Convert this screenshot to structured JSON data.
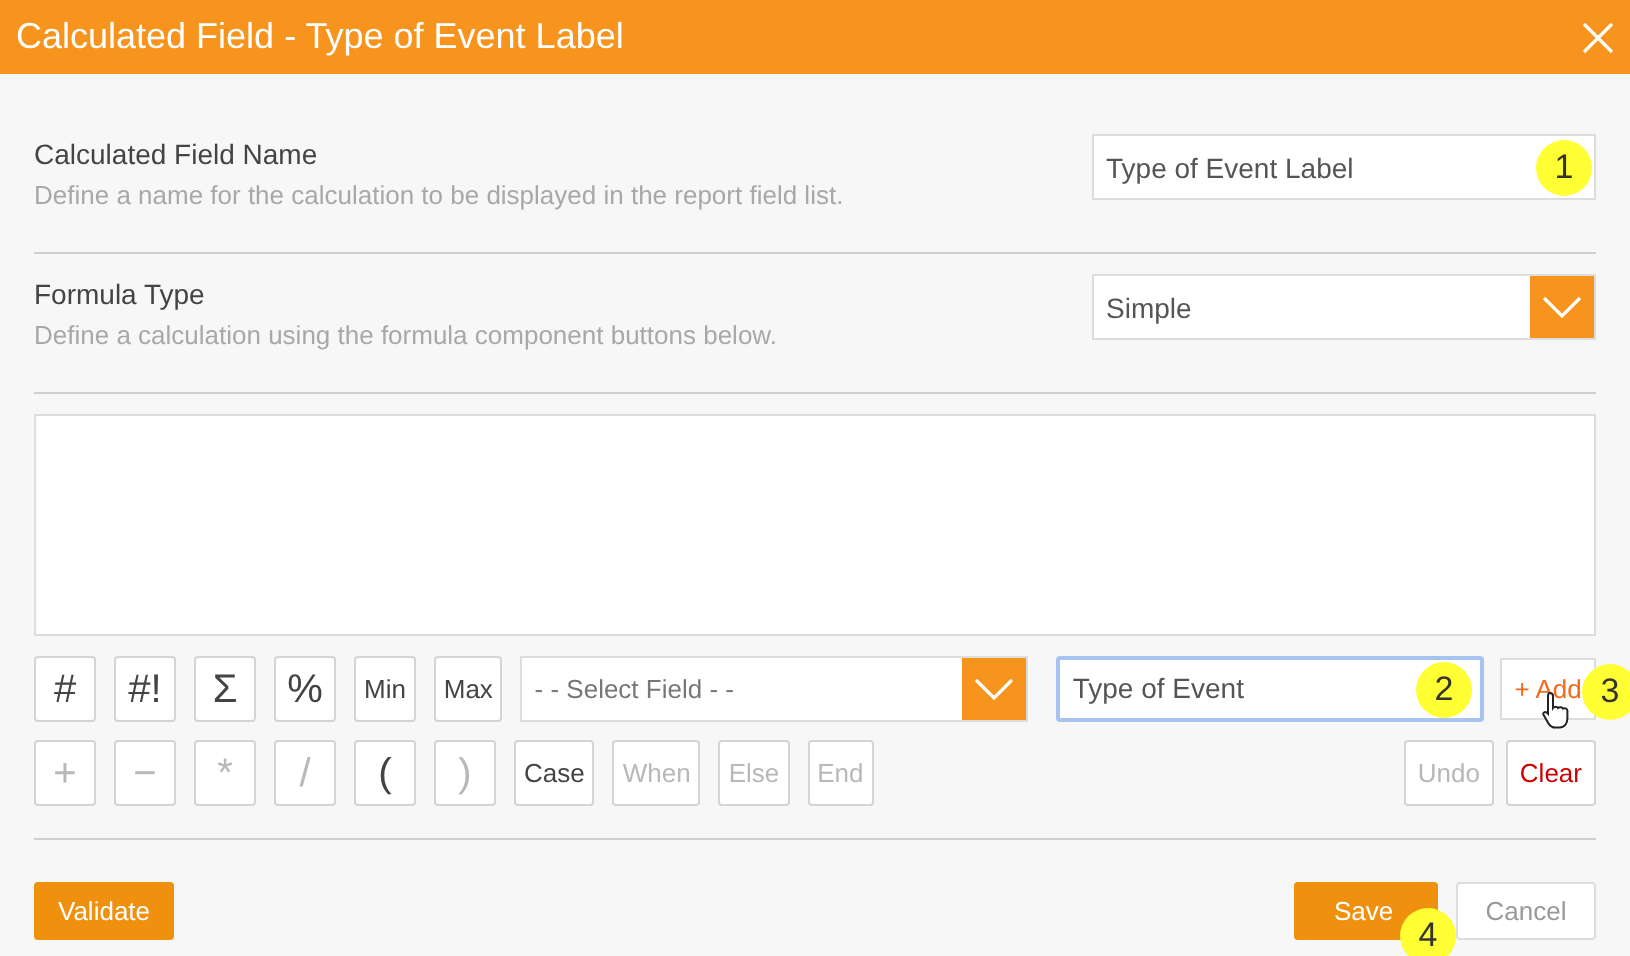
{
  "window": {
    "title": "Calculated Field - Type of Event Label"
  },
  "name_section": {
    "label": "Calculated Field Name",
    "description": "Define a name for the calculation to be displayed in the report field list.",
    "value": "Type of Event Label",
    "callout": "1"
  },
  "formula_section": {
    "label": "Formula Type",
    "description": "Define a calculation using the formula component buttons below.",
    "value": "Simple"
  },
  "operator_rows": [
    [
      {
        "label": "#",
        "disabled": false
      },
      {
        "label": "#!",
        "disabled": false
      },
      {
        "label": "Σ",
        "disabled": false
      },
      {
        "label": "%",
        "disabled": false
      },
      {
        "label": "Min",
        "disabled": false
      },
      {
        "label": "Max",
        "disabled": false
      }
    ],
    [
      {
        "label": "+",
        "disabled": true
      },
      {
        "label": "−",
        "disabled": true
      },
      {
        "label": "*",
        "disabled": true
      },
      {
        "label": "/",
        "disabled": true
      },
      {
        "label": "(",
        "disabled": false
      },
      {
        "label": ")",
        "disabled": true
      },
      {
        "label": "Case",
        "disabled": false
      },
      {
        "label": "When",
        "disabled": true
      },
      {
        "label": "Else",
        "disabled": true
      },
      {
        "label": "End",
        "disabled": true
      }
    ]
  ],
  "field_select": {
    "placeholder": "- - Select Field - -"
  },
  "field_input": {
    "value": "Type of Event",
    "callout": "2"
  },
  "add_button": {
    "label": "+ Add",
    "callout": "3"
  },
  "edit_buttons": [
    {
      "label": "Undo",
      "disabled": true,
      "kind": "normal"
    },
    {
      "label": "Clear",
      "disabled": false,
      "kind": "danger"
    }
  ],
  "footer": {
    "validate": "Validate",
    "save": "Save",
    "save_callout": "4",
    "cancel": "Cancel"
  }
}
